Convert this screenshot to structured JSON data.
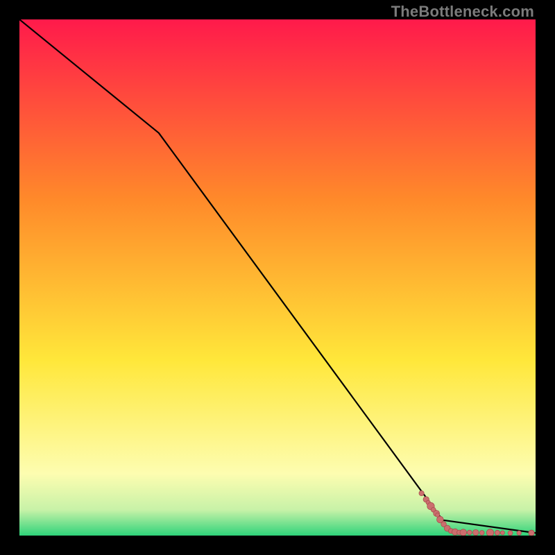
{
  "watermark": "TheBottleneck.com",
  "colors": {
    "gradient_top": "#ff1a4b",
    "gradient_mid_orange": "#ff8a2a",
    "gradient_yellow": "#ffe73a",
    "gradient_pale_yellow": "#fdfdb0",
    "gradient_green": "#2fd37a",
    "line": "#000000",
    "dot_fill": "#cb6e6e",
    "dot_stroke": "#a94e4e",
    "frame": "#000000"
  },
  "chart_data": {
    "type": "line",
    "title": "",
    "xlabel": "",
    "ylabel": "",
    "xlim": [
      0,
      100
    ],
    "ylim": [
      0,
      100
    ],
    "grid": false,
    "legend": false,
    "annotations": [],
    "series": [
      {
        "name": "curve",
        "kind": "line",
        "x": [
          0,
          27,
          82,
          100
        ],
        "y": [
          100,
          78,
          3,
          0.5
        ]
      },
      {
        "name": "points",
        "kind": "scatter",
        "points": [
          {
            "x": 77.9,
            "y": 8.2,
            "r": 3.6
          },
          {
            "x": 78.8,
            "y": 7.0,
            "r": 4.2
          },
          {
            "x": 79.2,
            "y": 6.4,
            "r": 3.2
          },
          {
            "x": 79.7,
            "y": 5.7,
            "r": 5.2
          },
          {
            "x": 80.2,
            "y": 5.0,
            "r": 3.4
          },
          {
            "x": 80.8,
            "y": 4.3,
            "r": 4.4
          },
          {
            "x": 81.0,
            "y": 4.0,
            "r": 3.0
          },
          {
            "x": 81.5,
            "y": 3.1,
            "r": 4.8
          },
          {
            "x": 82.2,
            "y": 2.2,
            "r": 3.8
          },
          {
            "x": 82.9,
            "y": 1.4,
            "r": 4.4
          },
          {
            "x": 83.6,
            "y": 0.9,
            "r": 3.6
          },
          {
            "x": 84.4,
            "y": 0.7,
            "r": 4.6
          },
          {
            "x": 85.2,
            "y": 0.6,
            "r": 3.4
          },
          {
            "x": 86.0,
            "y": 0.6,
            "r": 4.8
          },
          {
            "x": 87.2,
            "y": 0.6,
            "r": 3.4
          },
          {
            "x": 88.4,
            "y": 0.6,
            "r": 4.2
          },
          {
            "x": 89.6,
            "y": 0.55,
            "r": 3.4
          },
          {
            "x": 91.2,
            "y": 0.55,
            "r": 5.2
          },
          {
            "x": 92.6,
            "y": 0.55,
            "r": 3.6
          },
          {
            "x": 93.6,
            "y": 0.55,
            "r": 3.0
          },
          {
            "x": 95.1,
            "y": 0.5,
            "r": 3.4
          },
          {
            "x": 96.8,
            "y": 0.5,
            "r": 3.2
          },
          {
            "x": 99.2,
            "y": 0.5,
            "r": 4.2
          }
        ]
      }
    ]
  }
}
